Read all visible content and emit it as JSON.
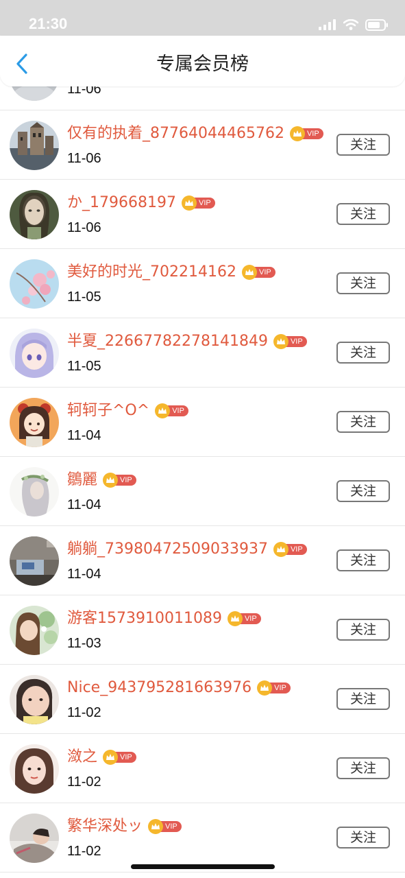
{
  "status_bar": {
    "time": "21:30",
    "icons": [
      "signal-icon",
      "wifi-icon",
      "battery-icon"
    ]
  },
  "nav": {
    "back_icon": "chevron-left-icon",
    "title": "专属会员榜"
  },
  "vip_label": "VIP",
  "follow_label": "关注",
  "colors": {
    "name": "#e05a3e",
    "vip_badge": "#e25a52",
    "crown": "#f5b72c",
    "back_icon": "#2b9be6"
  },
  "members": [
    {
      "name": "",
      "date": "11-06",
      "vip": false,
      "avatar": "partial-gray"
    },
    {
      "name": "仅有的执着_87764044465762",
      "date": "11-06",
      "vip": true,
      "avatar": "castle"
    },
    {
      "name": "か_179668197",
      "date": "11-06",
      "vip": true,
      "avatar": "doll"
    },
    {
      "name": "美好的时光_702214162",
      "date": "11-05",
      "vip": true,
      "avatar": "blossom"
    },
    {
      "name": "半夏_22667782278141849",
      "date": "11-05",
      "vip": true,
      "avatar": "anime"
    },
    {
      "name": "轲轲子^O^",
      "date": "11-04",
      "vip": true,
      "avatar": "cartoon"
    },
    {
      "name": "鶵麗",
      "date": "11-04",
      "vip": true,
      "avatar": "wreath"
    },
    {
      "name": "躺躺_73980472509033937",
      "date": "11-04",
      "vip": true,
      "avatar": "room"
    },
    {
      "name": "游客1573910011089",
      "date": "11-03",
      "vip": true,
      "avatar": "flowers"
    },
    {
      "name": "Nice_943795281663976",
      "date": "11-02",
      "vip": true,
      "avatar": "child"
    },
    {
      "name": "潋之",
      "date": "11-02",
      "vip": true,
      "avatar": "portrait"
    },
    {
      "name": "繁华深处ッ",
      "date": "11-02",
      "vip": true,
      "avatar": "sleeper"
    }
  ]
}
